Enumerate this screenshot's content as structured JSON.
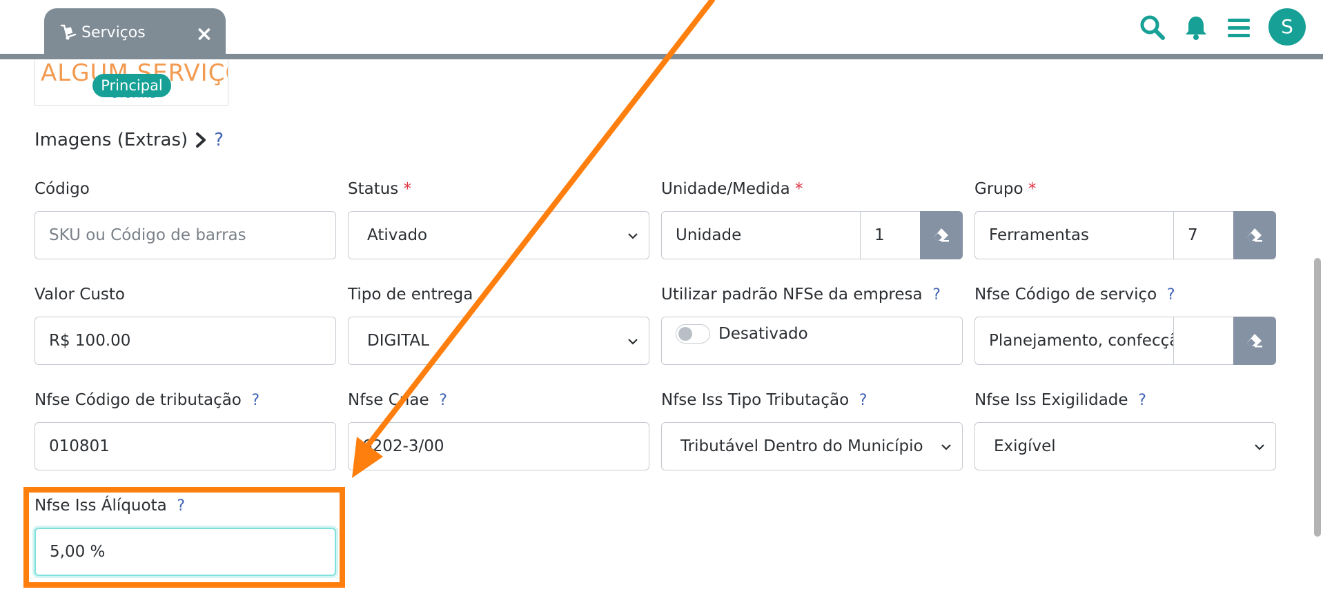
{
  "header": {
    "tab_label": "Serviços",
    "tab_close": "×",
    "avatar_letter": "S",
    "accent_color": "#17a096",
    "tab_color": "#7f8c96"
  },
  "logo": {
    "text": "ALGUM SERVIÇO",
    "sub": "DIGITAL",
    "badge": "Principal"
  },
  "extras": {
    "label": "Imagens (Extras)",
    "help": "?"
  },
  "form": {
    "codigo": {
      "label": "Código",
      "placeholder": "SKU ou Código de barras"
    },
    "status": {
      "label": "Status",
      "required": "*",
      "value": "Ativado"
    },
    "unidade": {
      "label": "Unidade/Medida",
      "required": "*",
      "value": "Unidade",
      "id": "1"
    },
    "grupo": {
      "label": "Grupo",
      "required": "*",
      "value": "Ferramentas",
      "id": "7"
    },
    "valor_custo": {
      "label": "Valor Custo",
      "value": "R$ 100.00"
    },
    "tipo_entrega": {
      "label": "Tipo de entrega",
      "value": "DIGITAL"
    },
    "padrao_nfse": {
      "label": "Utilizar padrão NFSe da empresa",
      "help": "?",
      "value": "Desativado"
    },
    "nfse_codigo_servico": {
      "label": "Nfse Código de serviço",
      "help": "?",
      "value": "Planejamento, confecção"
    },
    "nfse_codigo_tributacao": {
      "label": "Nfse Código de tributação",
      "help": "?",
      "value": "010801"
    },
    "nfse_cnae": {
      "label": "Nfse Cnae",
      "help": "?",
      "value": "6202-3/00"
    },
    "nfse_iss_tipo": {
      "label": "Nfse Iss Tipo Tributação",
      "help": "?",
      "value": "Tributável Dentro do Município"
    },
    "nfse_iss_exigibilidade": {
      "label": "Nfse Iss Exigilidade",
      "help": "?",
      "value": "Exigível"
    },
    "nfse_iss_aliquota": {
      "label": "Nfse Iss Álíquota",
      "help": "?",
      "value": "5,00 %"
    }
  },
  "annotation": {
    "color": "#ff7f0e"
  }
}
